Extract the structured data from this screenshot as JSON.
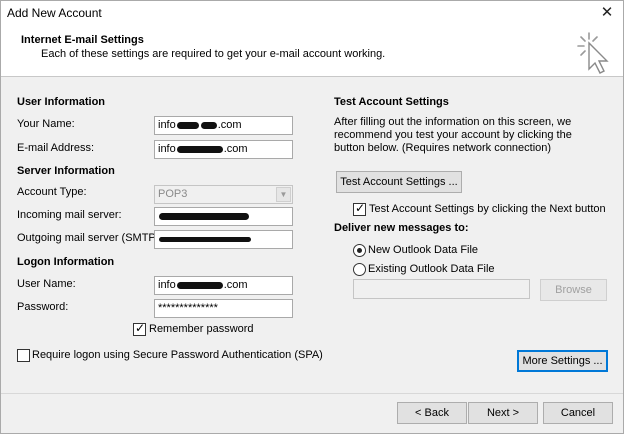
{
  "window": {
    "title": "Add New Account"
  },
  "header": {
    "title": "Internet E-mail Settings",
    "subtitle": "Each of these settings are required to get your e-mail account working."
  },
  "user_info": {
    "heading": "User Information",
    "name_label": "Your Name:",
    "name_prefix": "info",
    "name_suffix": ".com",
    "email_label": "E-mail Address:",
    "email_prefix": "info",
    "email_suffix": ".com"
  },
  "server_info": {
    "heading": "Server Information",
    "account_type_label": "Account Type:",
    "account_type_value": "POP3",
    "incoming_label": "Incoming mail server:",
    "outgoing_label": "Outgoing mail server (SMTP):"
  },
  "logon_info": {
    "heading": "Logon Information",
    "username_label": "User Name:",
    "username_prefix": "info",
    "username_suffix": ".com",
    "password_label": "Password:",
    "password_value": "**************",
    "remember_label": "Remember password",
    "spa_label": "Require logon using Secure Password Authentication (SPA)"
  },
  "test_settings": {
    "heading": "Test Account Settings",
    "description": "After filling out the information on this screen, we recommend you test your account by clicking the button below. (Requires network connection)",
    "test_button": "Test Account Settings ...",
    "test_next_label": "Test Account Settings by clicking the Next button"
  },
  "deliver": {
    "heading": "Deliver new messages to:",
    "new_file_label": "New Outlook Data File",
    "existing_file_label": "Existing Outlook Data File",
    "browse_button": "Browse"
  },
  "buttons": {
    "more_settings": "More Settings ...",
    "back": "< Back",
    "next": "Next >",
    "cancel": "Cancel"
  },
  "state": {
    "remember_password": true,
    "require_spa": false,
    "test_on_next": true,
    "deliver_selected": "new"
  },
  "colors": {
    "focus": "#0078d7",
    "header_bg": "#ffffff",
    "body_bg": "#f0f0f0"
  }
}
